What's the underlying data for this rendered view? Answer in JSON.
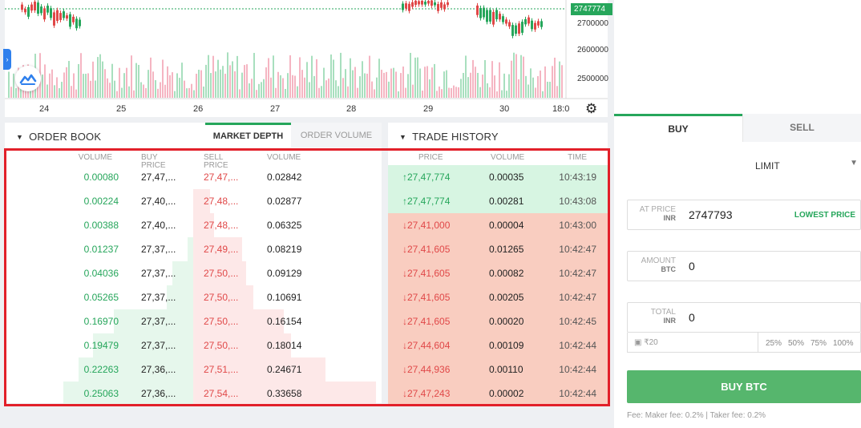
{
  "chart": {
    "last_price_tag": "2747774",
    "y_labels": [
      "2700000",
      "2600000",
      "2500000"
    ],
    "x_labels": [
      "24",
      "25",
      "26",
      "27",
      "28",
      "29",
      "30",
      "18:0"
    ]
  },
  "order_book": {
    "title": "ORDER BOOK",
    "tabs": [
      "MARKET DEPTH",
      "ORDER VOLUME"
    ],
    "headers": {
      "bid_volume": "VOLUME",
      "buy_price": "BUY PRICE",
      "sell_price": "SELL PRICE",
      "ask_volume": "VOLUME"
    },
    "rows": [
      {
        "bid_volume": "0.00080",
        "buy_price": "27,47,...",
        "sell_price": "27,47,...",
        "ask_volume": "0.02842",
        "bid_depth": 0.0,
        "ask_depth": 0.0
      },
      {
        "bid_volume": "0.00224",
        "buy_price": "27,40,...",
        "sell_price": "27,48,...",
        "ask_volume": "0.02877",
        "bid_depth": 0.0,
        "ask_depth": 0.09
      },
      {
        "bid_volume": "0.00388",
        "buy_price": "27,40,...",
        "sell_price": "27,48,...",
        "ask_volume": "0.06325",
        "bid_depth": 0.0,
        "ask_depth": 0.11
      },
      {
        "bid_volume": "0.01237",
        "buy_price": "27,37,...",
        "sell_price": "27,49,...",
        "ask_volume": "0.08219",
        "bid_depth": 0.03,
        "ask_depth": 0.26
      },
      {
        "bid_volume": "0.04036",
        "buy_price": "27,37,...",
        "sell_price": "27,50,...",
        "ask_volume": "0.09129",
        "bid_depth": 0.11,
        "ask_depth": 0.28
      },
      {
        "bid_volume": "0.05265",
        "buy_price": "27,37,...",
        "sell_price": "27,50,...",
        "ask_volume": "0.10691",
        "bid_depth": 0.14,
        "ask_depth": 0.32
      },
      {
        "bid_volume": "0.16970",
        "buy_price": "27,37,...",
        "sell_price": "27,50,...",
        "ask_volume": "0.16154",
        "bid_depth": 0.42,
        "ask_depth": 0.48
      },
      {
        "bid_volume": "0.19479",
        "buy_price": "27,37,...",
        "sell_price": "27,50,...",
        "ask_volume": "0.18014",
        "bid_depth": 0.53,
        "ask_depth": 0.52
      },
      {
        "bid_volume": "0.22263",
        "buy_price": "27,36,...",
        "sell_price": "27,51,...",
        "ask_volume": "0.24671",
        "bid_depth": 0.61,
        "ask_depth": 0.7
      },
      {
        "bid_volume": "0.25063",
        "buy_price": "27,36,...",
        "sell_price": "27,54,...",
        "ask_volume": "0.33658",
        "bid_depth": 0.69,
        "ask_depth": 0.97
      }
    ]
  },
  "trade_history": {
    "title": "TRADE HISTORY",
    "headers": {
      "price": "PRICE",
      "volume": "VOLUME",
      "time": "TIME"
    },
    "rows": [
      {
        "dir": "up",
        "price": "27,47,774",
        "volume": "0.00035",
        "time": "10:43:19"
      },
      {
        "dir": "up",
        "price": "27,47,774",
        "volume": "0.00281",
        "time": "10:43:08"
      },
      {
        "dir": "down",
        "price": "27,41,000",
        "volume": "0.00004",
        "time": "10:43:00"
      },
      {
        "dir": "down",
        "price": "27,41,605",
        "volume": "0.01265",
        "time": "10:42:47"
      },
      {
        "dir": "down",
        "price": "27,41,605",
        "volume": "0.00082",
        "time": "10:42:47"
      },
      {
        "dir": "down",
        "price": "27,41,605",
        "volume": "0.00205",
        "time": "10:42:47"
      },
      {
        "dir": "down",
        "price": "27,41,605",
        "volume": "0.00020",
        "time": "10:42:45"
      },
      {
        "dir": "down",
        "price": "27,44,604",
        "volume": "0.00109",
        "time": "10:42:44"
      },
      {
        "dir": "down",
        "price": "27,44,936",
        "volume": "0.00110",
        "time": "10:42:44"
      },
      {
        "dir": "down",
        "price": "27,47,243",
        "volume": "0.00002",
        "time": "10:42:44"
      }
    ]
  },
  "trade_panel": {
    "tabs": {
      "buy": "BUY",
      "sell": "SELL"
    },
    "order_type": "LIMIT",
    "at_price": {
      "label": "AT PRICE",
      "unit": "INR",
      "value": "2747793",
      "link": "LOWEST PRICE"
    },
    "amount": {
      "label": "AMOUNT",
      "unit": "BTC",
      "value": "0"
    },
    "total": {
      "label": "TOTAL",
      "unit": "INR",
      "value": "0"
    },
    "balance": "₹20",
    "percent_options": [
      "25%",
      "50%",
      "75%",
      "100%"
    ],
    "submit": "BUY BTC",
    "fees": "Fee: Maker fee: 0.2% | Taker fee: 0.2%"
  },
  "colors": {
    "green": "#26a65b",
    "red": "#e04848",
    "highlight": "#e2202a"
  }
}
